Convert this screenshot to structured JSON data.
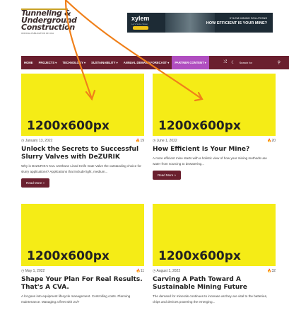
{
  "header": {
    "logo_line1": "Tunneling &",
    "logo_line2": "Underground",
    "logo_line3": "Construction",
    "logo_sub": "OFFICIAL PUBLICATION OF UCA",
    "banner": {
      "brand": "xylem",
      "tagline": "Let's Solve Water",
      "cta_top": "XYLEM MINING SOLUTIONS",
      "cta_main": "HOW EFFICIENT IS YOUR MINE?"
    }
  },
  "nav": {
    "items": [
      "HOME",
      "PROJECTS ▾",
      "TECHNOLOGY ▾",
      "SUSTAINABILITY ▾",
      "ANNUAL DEMAND FORECAST ▾",
      "PARTNER CONTENT ▾"
    ],
    "active_index": 5,
    "search_placeholder": "Search for",
    "icons": [
      "shuffle-icon",
      "moon-icon",
      "search-icon"
    ]
  },
  "placeholder_label": "1200x600px",
  "cards": [
    {
      "date": "January 13, 2022",
      "views": "19",
      "title": "Unlock the Secrets to Successful Slurry Valves with DeZURIK",
      "excerpt": "Why is DeZURIK's KUL Urethane Lined Knife Gate Valve the outstanding choice for slurry applications? Applications that include light, medium...",
      "button": "Read More »"
    },
    {
      "date": "June 1, 2022",
      "views": "20",
      "title": "How Efficient Is Your Mine?",
      "excerpt": "A more efficient mine starts with a holistic view of how your mining methods use water from sourcing to dewatering...",
      "button": "Read More »"
    },
    {
      "date": "May 1, 2022",
      "views": "11",
      "title": "Shape Your Plan For Real Results. That's A CVA.",
      "excerpt": "A lot goes into equipment lifecycle management. Controlling costs. Planning maintenance. Managing a fleet with 24/7",
      "button": ""
    },
    {
      "date": "August 1, 2022",
      "views": "32",
      "title": "Carving A Path Toward A Sustainable Mining Future",
      "excerpt": "The demand for minerals continues to increase as they are vital to the batteries, chips and devices powering the emerging...",
      "button": ""
    }
  ],
  "colors": {
    "nav_bg": "#6a1f2e",
    "nav_active": "#b04ec0",
    "placeholder_bg": "#f5ec16",
    "arrow": "#f0801a"
  }
}
